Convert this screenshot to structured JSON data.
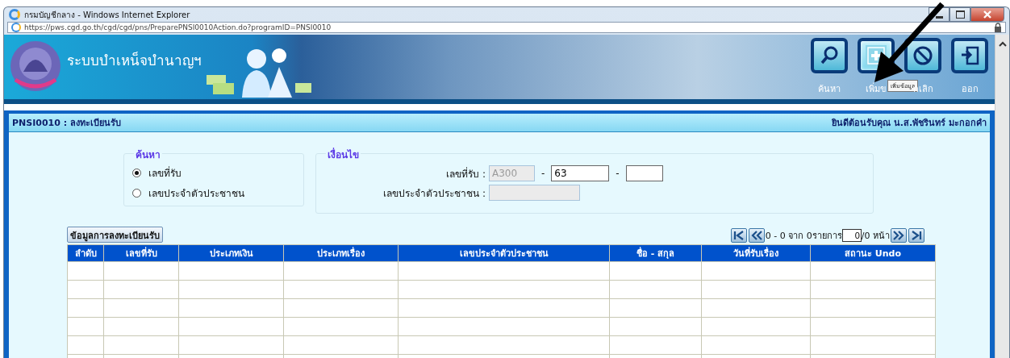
{
  "window": {
    "title": "กรมบัญชีกลาง - Windows Internet Explorer"
  },
  "address_bar": {
    "url": "https://pws.cgd.go.th/cgd/cgd/pns/PreparePNSI0010Action.do?programID=PNSI0010"
  },
  "header": {
    "system_title": "ระบบบำเหน็จบำนาญฯ",
    "toolbar": [
      {
        "kind": "search",
        "label": "ค้นหา",
        "highlighted": false
      },
      {
        "kind": "add",
        "label": "เพิ่มข",
        "highlighted": true
      },
      {
        "kind": "cancel",
        "label": "กเลิก",
        "highlighted": false
      },
      {
        "kind": "exit",
        "label": "ออก",
        "highlighted": false
      }
    ],
    "tooltip": "เพิ่มข้อมูล"
  },
  "panel": {
    "title": "PNSI0010 : ลงทะเบียนรับ",
    "welcome": "ยินดีต้อนรับคุณ น.ส.พัชรินทร์ มะกอกคำ"
  },
  "search_group": {
    "legend": "ค้นหา",
    "options": [
      {
        "label": "เลขที่รับ",
        "selected": true
      },
      {
        "label": "เลขประจำตัวประชาชน",
        "selected": false
      }
    ]
  },
  "condition_group": {
    "legend": "เงื่อนไข",
    "fields": [
      {
        "label": "เลขที่รับ :",
        "parts": [
          {
            "kind": "input",
            "value": "A300",
            "disabled": true
          },
          {
            "kind": "separator",
            "text": "-"
          },
          {
            "kind": "input",
            "value": "63",
            "disabled": false
          },
          {
            "kind": "separator",
            "text": "-"
          },
          {
            "kind": "input",
            "disabled": false
          }
        ]
      },
      {
        "label": "เลขประจำตัวประชาชน :",
        "parts": [
          {
            "kind": "input",
            "disabled": true
          }
        ]
      }
    ]
  },
  "table": {
    "caption_button": "ข้อมูลการลงทะเบียนรับ",
    "pagination": {
      "range": "0 - 0 จาก 0รายการ",
      "page": "0",
      "pages": "/0 หน้า"
    },
    "columns": [
      "ลำดับ",
      "เลขที่รับ",
      "ประเภทเงิน",
      "ประเภทเรื่อง",
      "เลขประจำตัวประชาชน",
      "ชื่อ - สกุล",
      "วันที่รับเรื่อง",
      "สถานะ Undo"
    ]
  }
}
